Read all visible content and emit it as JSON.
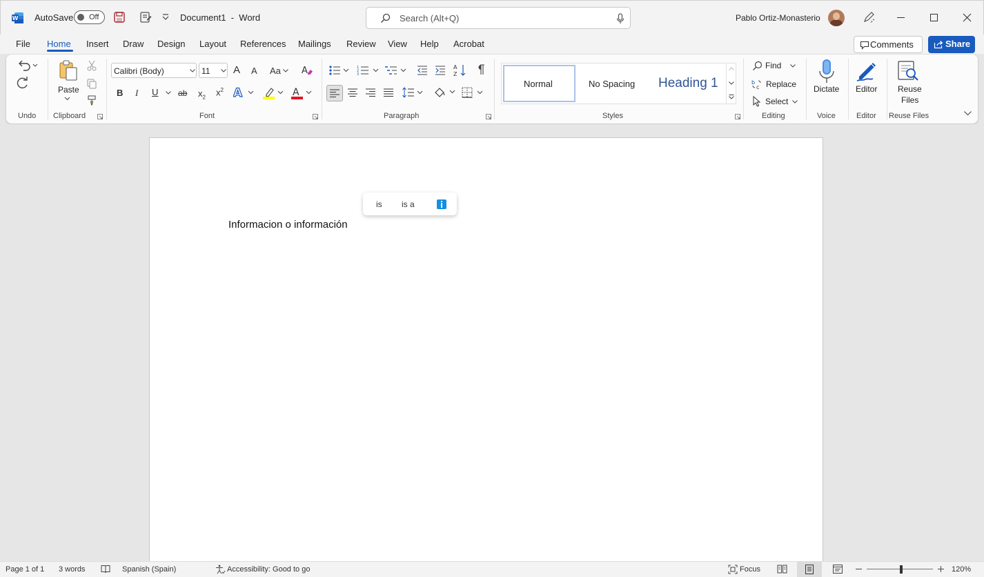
{
  "titlebar": {
    "autosave_label": "AutoSave",
    "autosave_state": "Off",
    "doc_name": "Document1",
    "separator": "-",
    "app_name": "Word",
    "search_placeholder": "Search (Alt+Q)",
    "user_name": "Pablo Ortiz-Monasterio"
  },
  "tabs": [
    "File",
    "Home",
    "Insert",
    "Draw",
    "Design",
    "Layout",
    "References",
    "Mailings",
    "Review",
    "View",
    "Help",
    "Acrobat"
  ],
  "active_tab": "Home",
  "actions": {
    "comments": "Comments",
    "share": "Share"
  },
  "ribbon": {
    "groups": {
      "undo": "Undo",
      "clipboard": "Clipboard",
      "font": "Font",
      "paragraph": "Paragraph",
      "styles": "Styles",
      "editing": "Editing",
      "voice": "Voice",
      "editor": "Editor",
      "reuse": "Reuse Files"
    },
    "paste_label": "Paste",
    "font_name": "Calibri (Body)",
    "font_size": "11",
    "font_buttons": {
      "bold": "B",
      "italic": "I",
      "underline": "U",
      "strike": "ab",
      "subscript": "x",
      "superscript": "x",
      "grow": "A",
      "shrink": "A",
      "case": "Aa"
    },
    "styles": [
      "Normal",
      "No Spacing",
      "Heading 1"
    ],
    "editing": {
      "find": "Find",
      "replace": "Replace",
      "select": "Select"
    },
    "dictate_label": "Dictate",
    "editor_label": "Editor",
    "reuse_label_1": "Reuse",
    "reuse_label_2": "Files"
  },
  "document": {
    "text": "Informacion o información",
    "suggestions": [
      "is",
      "is a"
    ]
  },
  "status": {
    "page": "Page 1 of 1",
    "words": "3 words",
    "language": "Spanish (Spain)",
    "accessibility": "Accessibility: Good to go",
    "focus": "Focus",
    "zoom": "120%",
    "zoom_level": 1.2
  },
  "colors": {
    "accent": "#185abd",
    "word_blue": "#185abd",
    "highlight": "#ffff00",
    "font_color": "#e81123"
  }
}
